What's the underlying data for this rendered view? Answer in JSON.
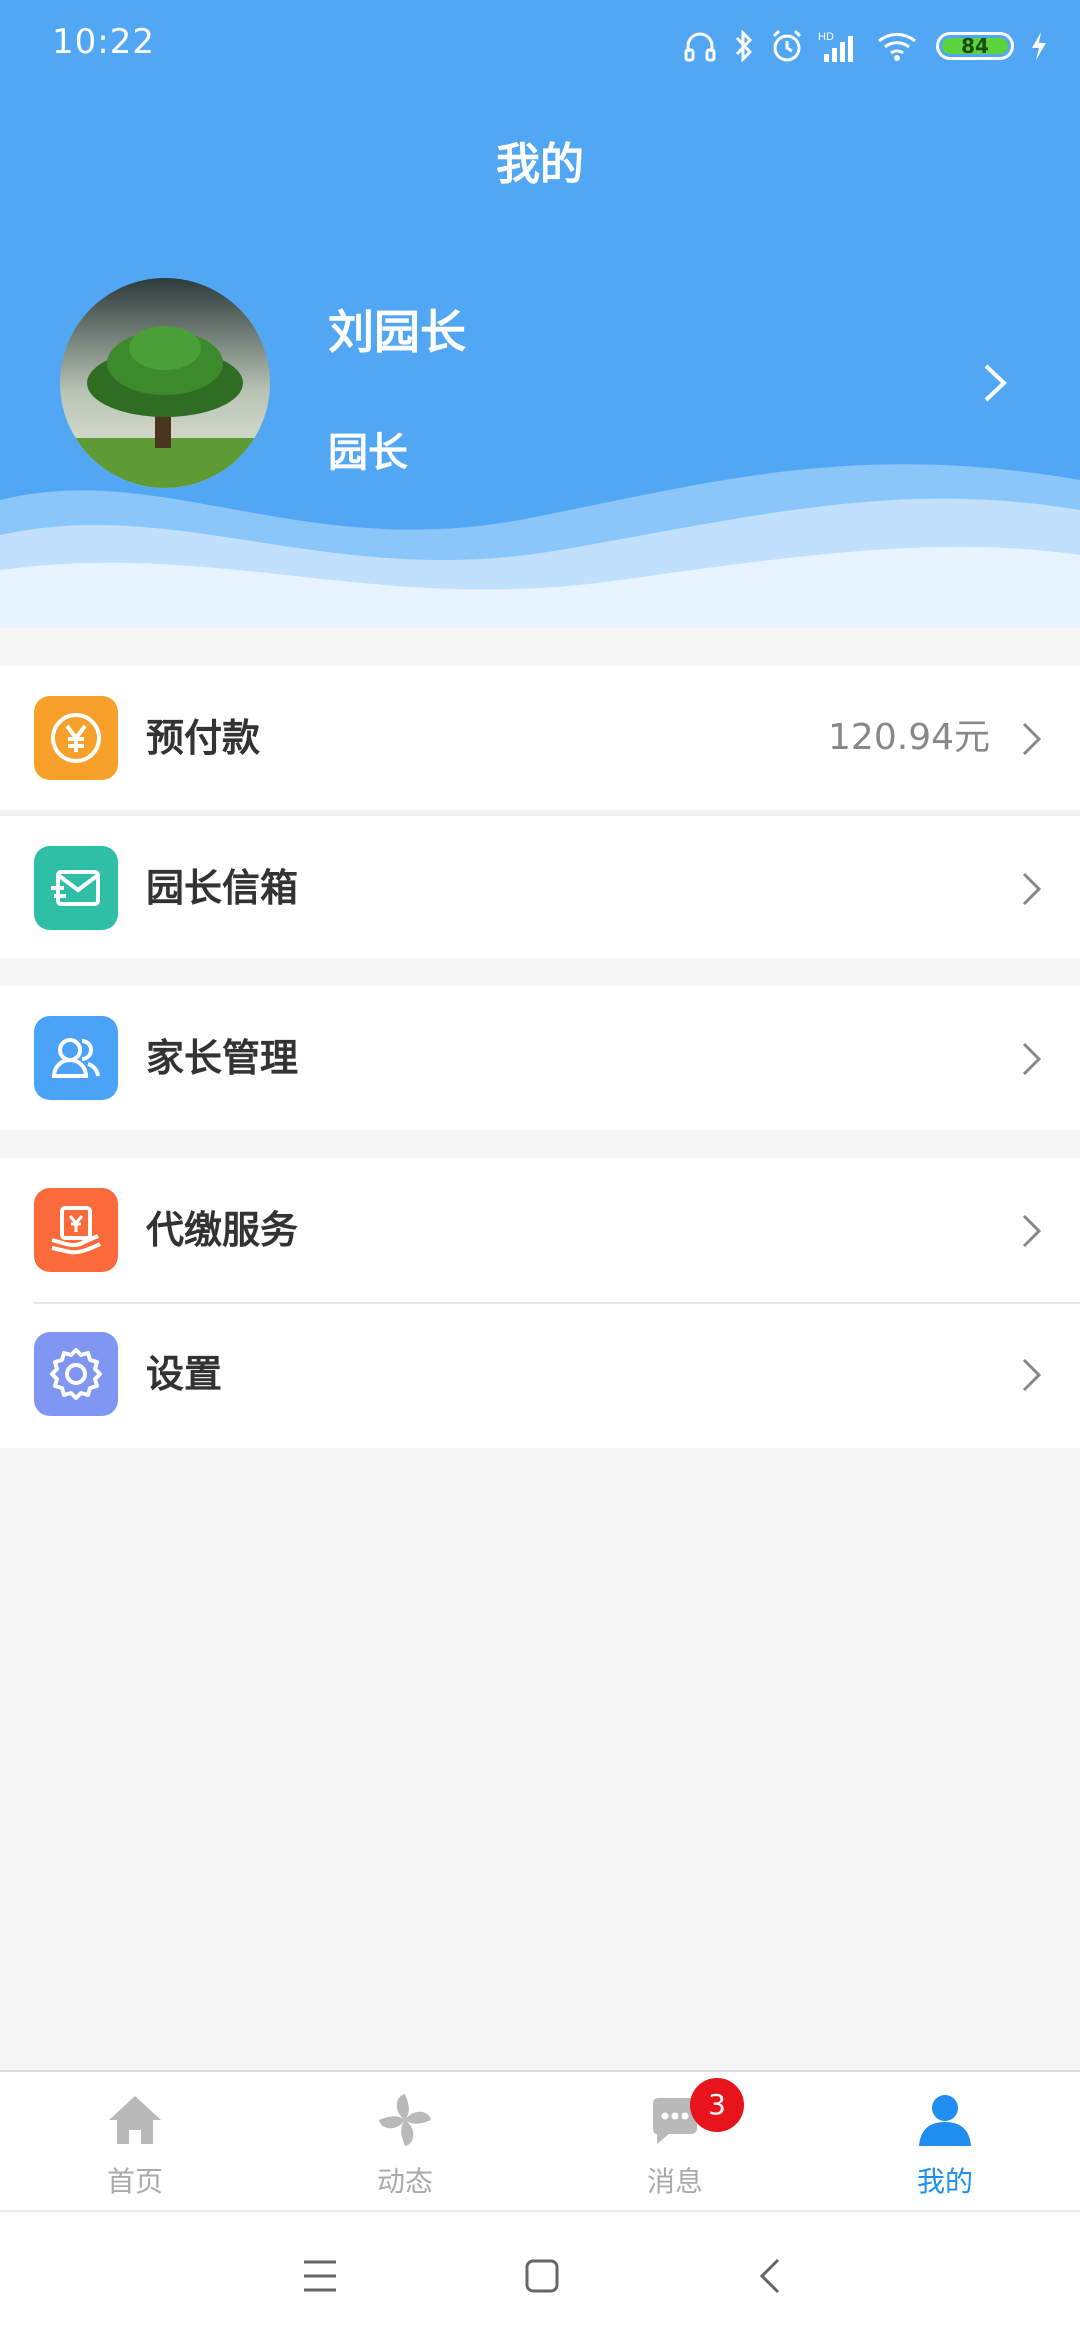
{
  "status_bar": {
    "time": "10:22",
    "battery": "84"
  },
  "header": {
    "title": "我的"
  },
  "profile": {
    "name": "刘园长",
    "role": "园长"
  },
  "menu": {
    "prepaid": {
      "label": "预付款",
      "value": "120.94元",
      "icon": "yen-icon",
      "color": "#f7a02a"
    },
    "mailbox": {
      "label": "园长信箱",
      "icon": "mail-icon",
      "color": "#2fbfa7"
    },
    "parents": {
      "label": "家长管理",
      "icon": "users-icon",
      "color": "#4aa3f6"
    },
    "payment": {
      "label": "代缴服务",
      "icon": "payment-icon",
      "color": "#fb6a3b"
    },
    "settings": {
      "label": "设置",
      "icon": "gear-icon",
      "color": "#7f97f2"
    }
  },
  "tabbar": {
    "tabs": [
      {
        "label": "首页",
        "icon": "home-icon"
      },
      {
        "label": "动态",
        "icon": "pinwheel-icon"
      },
      {
        "label": "消息",
        "icon": "chat-icon",
        "badge": "3"
      },
      {
        "label": "我的",
        "icon": "person-icon",
        "active": true
      }
    ]
  },
  "colors": {
    "primary": "#52a7f5",
    "active_tab": "#1f8ef0",
    "badge": "#e8141c"
  }
}
